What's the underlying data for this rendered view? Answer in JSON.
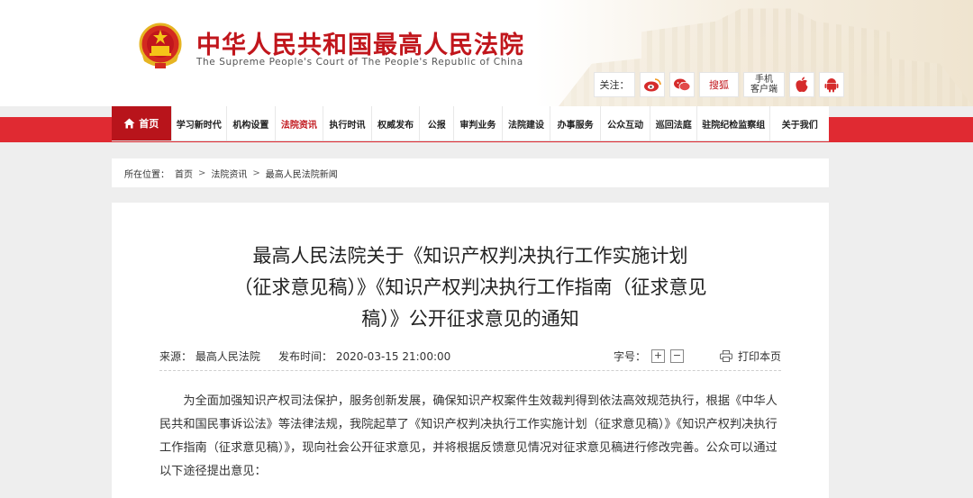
{
  "header": {
    "title_cn": "中华人民共和国最高人民法院",
    "title_en": "The Supreme People's Court of The People's Republic of China",
    "follow_label": "关注：",
    "sougou_label": "搜狐",
    "mobile_label_line1": "手机",
    "mobile_label_line2": "客户端",
    "brand_color": "#c1161c"
  },
  "nav": {
    "home_label": "首页",
    "items": [
      "学习新时代",
      "机构设置",
      "法院资讯",
      "执行时讯",
      "权威发布",
      "公报",
      "审判业务",
      "法院建设",
      "办事服务",
      "公众互动",
      "巡回法庭",
      "驻院纪检监察组",
      "关于我们"
    ],
    "active_index": 2
  },
  "breadcrumb": {
    "prefix": "所在位置：",
    "items": [
      "首页",
      "法院资讯",
      "最高人民法院新闻"
    ]
  },
  "article": {
    "title_line1": "最高人民法院关于《知识产权判决执行工作实施计划",
    "title_line2": "（征求意见稿）》《知识产权判决执行工作指南（征求意见",
    "title_line3": "稿）》公开征求意见的通知",
    "source": "来源：  最高人民法院",
    "publish_time": "发布时间：  2020-03-15 21:00:00",
    "font_size_label": "字号：",
    "plus": "+",
    "minus": "−",
    "print_label": "打印本页",
    "body": "为全面加强知识产权司法保护，服务创新发展，确保知识产权案件生效裁判得到依法高效规范执行，根据《中华人民共和国民事诉讼法》等法律法规，我院起草了《知识产权判决执行工作实施计划（征求意见稿）》《知识产权判决执行工作指南（征求意见稿）》，现向社会公开征求意见，并将根据反馈意见情况对征求意见稿进行修改完善。公众可以通过以下途径提出意见："
  }
}
